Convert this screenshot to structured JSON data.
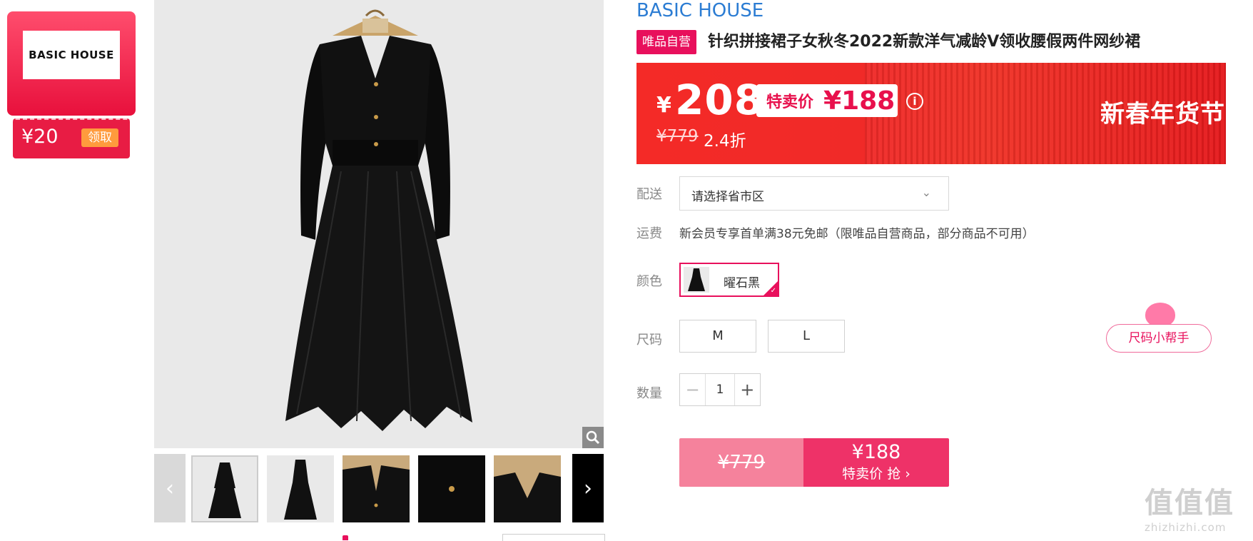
{
  "coupon": {
    "brand_logo_text": "BASIC HOUSE",
    "amount": "¥20",
    "claim_label": "领取"
  },
  "gallery": {
    "zoom_icon": "magnifier-icon",
    "prev_icon": "chevron-left-icon",
    "next_icon": "chevron-right-icon",
    "thumbnail_count": 5
  },
  "product": {
    "brand": "BASIC HOUSE",
    "badge": "唯品自营",
    "title": "针织拼接裙子女秋冬2022新款洋气减龄V领收腰假两件网纱裙"
  },
  "price": {
    "currency": "¥",
    "current": "208",
    "special_label": "特卖价",
    "special_price": "¥188",
    "original": "¥779",
    "discount": "2.4折",
    "festival": "新春年货节",
    "info_icon": "info-icon"
  },
  "delivery": {
    "label": "配送",
    "placeholder": "请选择省市区"
  },
  "shipping": {
    "label": "运费",
    "text": "新会员专享首单满38元免邮（限唯品自营商品，部分商品不可用）"
  },
  "color": {
    "label": "颜色",
    "selected": "曜石黑"
  },
  "size": {
    "label": "尺码",
    "options": [
      "M",
      "L"
    ],
    "helper": "尺码小帮手"
  },
  "quantity": {
    "label": "数量",
    "minus": "−",
    "value": "1",
    "plus": "+"
  },
  "buy": {
    "original": "¥779",
    "price": "¥188",
    "label": "特卖价 抢 ›"
  },
  "watermark": {
    "glyphs": "值值值",
    "url": "zhizhizhi.com"
  },
  "colors": {
    "brand_blue": "#2b7cd3",
    "accent_pink": "#e8105c",
    "banner_red": "#f02a28"
  }
}
